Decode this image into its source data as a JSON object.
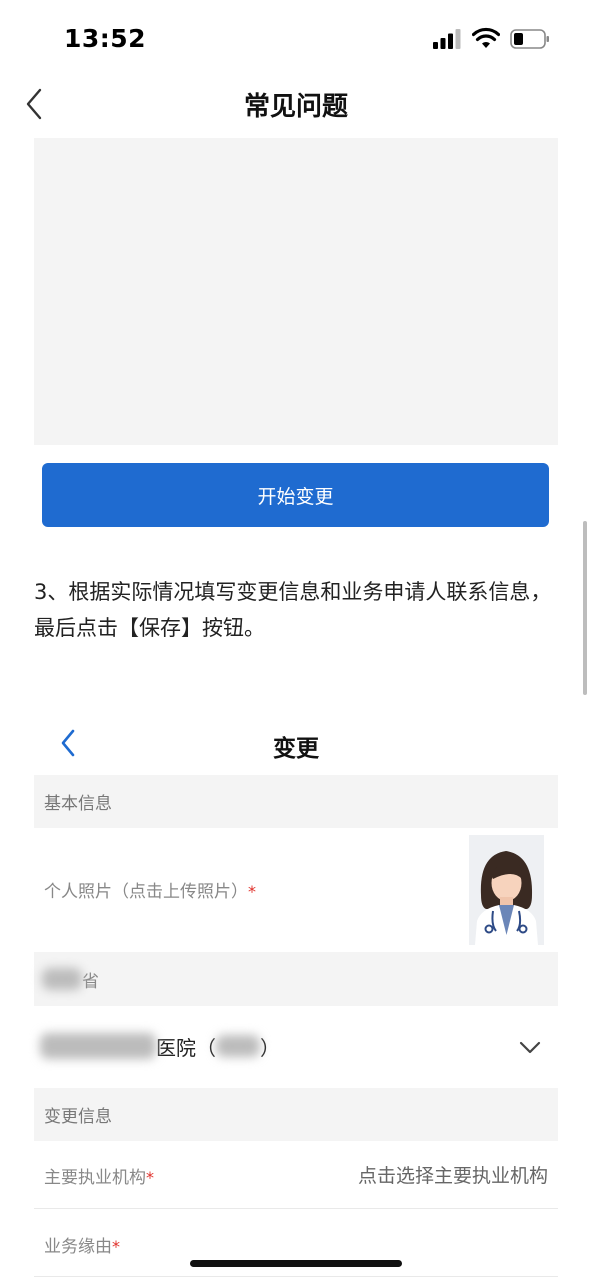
{
  "status_bar": {
    "time": "13:52"
  },
  "nav": {
    "title": "常见问题"
  },
  "start_button": {
    "label": "开始变更"
  },
  "instruction": {
    "text": "3、根据实际情况填写变更信息和业务申请人联系信息，最后点击【保存】按钮。"
  },
  "form": {
    "title": "变更",
    "section_basic": "基本信息",
    "photo_label": "个人照片（点击上传照片）",
    "required_mark": "*",
    "province_suffix": "省",
    "hospital_suffix": "医院（",
    "hospital_close": "）",
    "section_change": "变更信息",
    "institution_label": "主要执业机构",
    "institution_placeholder": "点击选择主要执业机构",
    "reason_label": "业务缘由"
  },
  "icons": {
    "back": "chevron-left-icon",
    "inner_back": "chevron-left-icon",
    "dropdown": "chevron-down-icon",
    "signal": "cellular-signal-icon",
    "wifi": "wifi-icon",
    "battery": "battery-icon"
  },
  "colors": {
    "primary": "#1f6bd0",
    "required": "#e0302a",
    "section_bg": "#f4f4f4"
  }
}
